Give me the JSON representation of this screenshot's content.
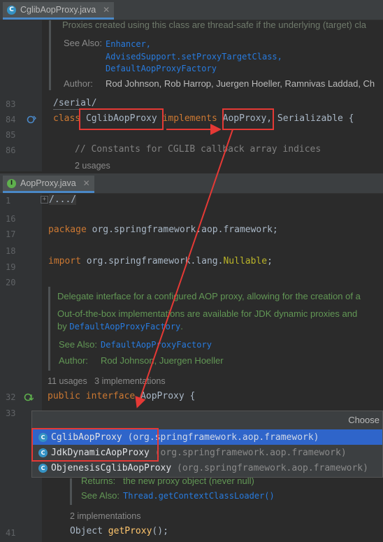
{
  "top_tab": {
    "title": "CglibAopProxy.java",
    "icon": "class-icon",
    "icon_color": "#3592c4"
  },
  "top_editor": {
    "doc_line_cut": "Proxies created using this class are thread-safe if the underlying (target) cla",
    "see_also_label": "See Also:",
    "see_also_links": [
      "Enhancer,",
      "AdvisedSupport.setProxyTargetClass,",
      "DefaultAopProxyFactory"
    ],
    "author_label": "Author:",
    "authors": "Rod Johnson, Rob Harrop, Juergen Hoeller, Ramnivas Laddad, Ch",
    "lines": [
      {
        "num": "83",
        "text": "/serial/"
      },
      {
        "num": "84",
        "kw1": "class",
        "cls": "CglibAopProxy",
        "kw2": "implements",
        "iface": "AopProxy",
        "rest": ", Serializable {"
      },
      {
        "num": "85",
        "text": ""
      },
      {
        "num": "86",
        "text": "// Constants for CGLIB callback array indices"
      }
    ],
    "usages": "2 usages"
  },
  "bottom_tab": {
    "title": "AopProxy.java",
    "icon": "interface-icon",
    "icon_color": "#5fb04d"
  },
  "bottom_editor": {
    "lines": [
      {
        "num": "1",
        "text": "/.../"
      },
      {
        "num": "16",
        "text": ""
      },
      {
        "num": "17",
        "kw": "package",
        "text": " org.springframework.aop.framework;"
      },
      {
        "num": "18",
        "text": ""
      },
      {
        "num": "19",
        "kw": "import",
        "pre": " org.springframework.lang.",
        "ann": "Nullable",
        "post": ";"
      },
      {
        "num": "20",
        "text": ""
      },
      {
        "num": "32",
        "kw": "public interface",
        "text": " AopProxy {"
      },
      {
        "num": "33",
        "text": ""
      },
      {
        "num": "41",
        "type": "Object",
        "method": "getProxy",
        "post": "();"
      }
    ],
    "doc1": "Delegate interface for a configured AOP proxy, allowing for the creation of a",
    "doc2": "Out-of-the-box implementations are available for JDK dynamic proxies and",
    "doc3_pre": "by ",
    "doc3_link": "DefaultAopProxyFactory",
    "doc3_post": ".",
    "see_also_label": "See Also:",
    "see_also_link": "DefaultAopProxyFactory",
    "author_label": "Author:",
    "authors": "Rod Johnson, Juergen Hoeller",
    "usage_hint": "11 usages   3 implementations",
    "returns_label": "Returns:",
    "returns_text": "the new proxy object (never null)",
    "see_also2_label": "See Also:",
    "see_also2_link": "Thread.getContextClassLoader()",
    "impl_hint": "2 implementations"
  },
  "popup": {
    "title": "Choose",
    "items": [
      {
        "name": "CglibAopProxy",
        "pkg": " (org.springframework.aop.framework)",
        "selected": true
      },
      {
        "name": "JdkDynamicAopProxy",
        "pkg": " (org.springframework.aop.framework)",
        "selected": false
      },
      {
        "name": "ObjenesisCglibAopProxy",
        "pkg": " (org.springframework.aop.framework)",
        "selected": false
      }
    ]
  },
  "colors": {
    "selection": "#2f65ca",
    "annotation_red": "#e53935",
    "keyword": "#cc7832",
    "doc_green": "#629755",
    "link": "#287bde"
  }
}
